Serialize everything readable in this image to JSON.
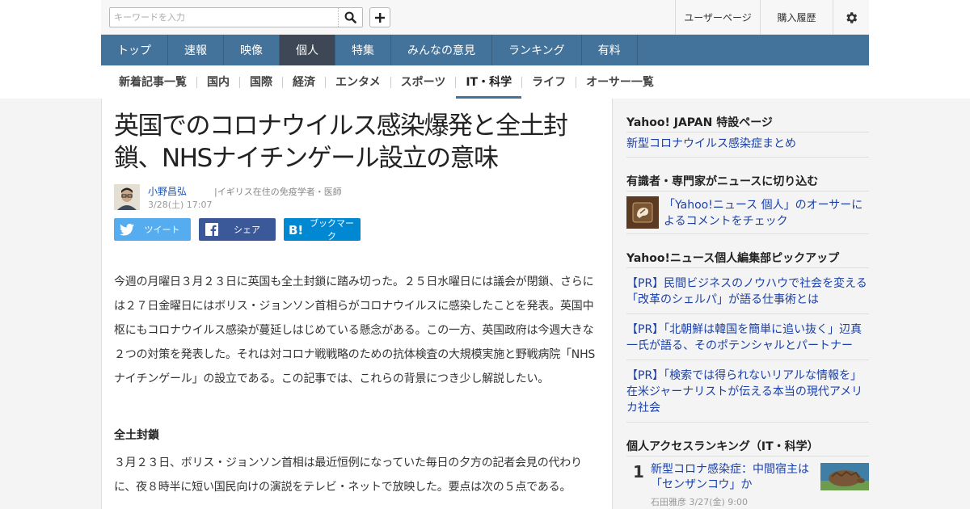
{
  "search": {
    "placeholder": "キーワードを入力"
  },
  "header": {
    "user_page": "ユーザーページ",
    "purchase_history": "購入履歴"
  },
  "gnav": [
    {
      "label": "トップ"
    },
    {
      "label": "速報"
    },
    {
      "label": "映像"
    },
    {
      "label": "個人"
    },
    {
      "label": "特集"
    },
    {
      "label": "みんなの意見"
    },
    {
      "label": "ランキング"
    },
    {
      "label": "有料"
    }
  ],
  "gnav_active_index": 3,
  "snav": [
    {
      "label": "新着記事一覧"
    },
    {
      "label": "国内"
    },
    {
      "label": "国際"
    },
    {
      "label": "経済"
    },
    {
      "label": "エンタメ"
    },
    {
      "label": "スポーツ"
    },
    {
      "label": "IT・科学"
    },
    {
      "label": "ライフ"
    },
    {
      "label": "オーサー一覧"
    }
  ],
  "snav_active_index": 6,
  "article": {
    "title": "英国でのコロナウイルス感染爆発と全土封鎖、NHSナイチンゲール設立の意味",
    "author_name": "小野昌弘",
    "author_desc": "イギリス在住の免疫学者・医師",
    "date": "3/28(土) 17:07",
    "share_tweet": "ツイート",
    "share_facebook": "シェア",
    "share_bookmark": "ブックマーク",
    "paragraph1": "今週の月曜日３月２３日に英国も全土封鎖に踏み切った。２５日水曜日には議会が閉鎖、さらには２７日金曜日にはボリス・ジョンソン首相らがコロナウイルスに感染したことを発表。英国中枢にもコロナウイルス感染が蔓延しはじめている懸念がある。この一方、英国政府は今週大きな２つの対策を発表した。それは対コロナ戦戦略のための抗体検査の大規模実施と野戦病院「NHSナイチンゲール」の設立である。この記事では、これらの背景につき少し解説したい。",
    "section_heading": "全土封鎖",
    "paragraph2": "３月２３日、ボリス・ジョンソン首相は最近恒例になっていた毎日の夕方の記者会見の代わりに、夜８時半に短い国民向けの演説をテレビ・ネットで放映した。要点は次の５点である。"
  },
  "sidebar": {
    "special_heading": "Yahoo! JAPAN 特設ページ",
    "special_link": "新型コロナウイルス感染症まとめ",
    "experts_heading": "有識者・専門家がニュースに切り込む",
    "experts_link": "「Yahoo!ニュース 個人」のオーサーによるコメントをチェック",
    "pickup_heading": "Yahoo!ニュース個人編集部ピックアップ",
    "pickup": [
      {
        "label": "【PR】民間ビジネスのノウハウで社会を変える　「改革のシェルパ」が語る仕事術とは"
      },
      {
        "label": "【PR】「北朝鮮は韓国を簡単に追い抜く」辺真一氏が語る、そのポテンシャルとパートナー"
      },
      {
        "label": "【PR】「検索では得られないリアルな情報を」在米ジャーナリストが伝える本当の現代アメリカ社会"
      }
    ],
    "ranking_heading": "個人アクセスランキング（IT・科学）",
    "ranking_rank": "1",
    "ranking_title": "新型コロナ感染症：中間宿主は「センザンコウ」か",
    "ranking_meta": "石田雅彦  3/27(金) 9:00"
  }
}
